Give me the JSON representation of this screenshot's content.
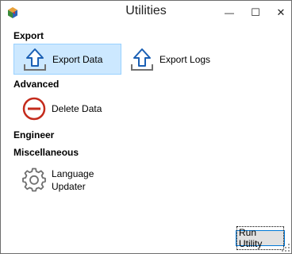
{
  "window": {
    "title": "Utilities",
    "minimize_glyph": "—",
    "maximize_glyph": "☐",
    "close_glyph": "✕"
  },
  "sections": {
    "export": {
      "heading": "Export",
      "items": [
        {
          "label": "Export Data",
          "icon": "upload-arrow-icon",
          "selected": true
        },
        {
          "label": "Export Logs",
          "icon": "upload-arrow-icon",
          "selected": false
        }
      ]
    },
    "advanced": {
      "heading": "Advanced",
      "items": [
        {
          "label": "Delete Data",
          "icon": "minus-circle-icon"
        }
      ]
    },
    "engineer": {
      "heading": "Engineer"
    },
    "miscellaneous": {
      "heading": "Miscellaneous",
      "items": [
        {
          "label_line1": "Language",
          "label_line2": "Updater",
          "icon": "gear-icon"
        }
      ]
    }
  },
  "footer": {
    "run_label": "Run Utility"
  },
  "colors": {
    "selection_bg": "#cce8ff",
    "upload_icon_blue": "#1a5fb4",
    "delete_icon_red": "#c42b1c",
    "gear_gray": "#707070"
  }
}
